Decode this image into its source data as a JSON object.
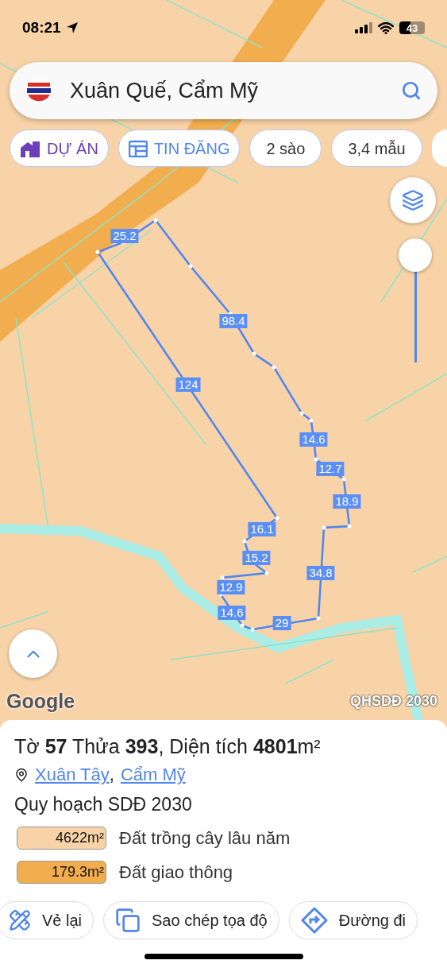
{
  "status_bar": {
    "time": "08:21",
    "battery": "43"
  },
  "search": {
    "value": "Xuân Quế, Cẩm Mỹ"
  },
  "chips": [
    {
      "kind": "project",
      "label": "DỰ ÁN"
    },
    {
      "kind": "listing",
      "label": "TIN ĐĂNG"
    },
    {
      "kind": "plain",
      "label": "2 sào"
    },
    {
      "kind": "plain",
      "label": "3,4 mẫu"
    }
  ],
  "opacity_slider": {
    "level": 1
  },
  "parcel": {
    "edges": [
      "25.2",
      "98.4",
      "124",
      "14.6",
      "12.7",
      "18.9",
      "16.1",
      "15.2",
      "12.9",
      "34.8",
      "14.6",
      "29"
    ]
  },
  "map_attribution": "Google",
  "layer_label": "QHSDĐ 2030",
  "sheet": {
    "title": "Tờ **57** Thửa **393**, Diện tích **4801**m²",
    "location": [
      {
        "text": "Xuân Tây"
      },
      {
        "text": "Cẩm Mỹ"
      }
    ],
    "location_separator": ",",
    "plan_title": "Quy hoạch SDĐ 2030",
    "land_use": [
      {
        "area": "4622m²",
        "label": "Đất trồng cây lâu năm",
        "color": "#f8d3a8"
      },
      {
        "area": "179.3m²",
        "label": "Đất giao thông",
        "color": "#f2ae4e"
      }
    ],
    "actions": [
      {
        "kind": "redraw",
        "label": "Vẻ lại"
      },
      {
        "kind": "copy",
        "label": "Sao chép tọa độ"
      },
      {
        "kind": "directions",
        "label": "Đường đi"
      }
    ]
  }
}
